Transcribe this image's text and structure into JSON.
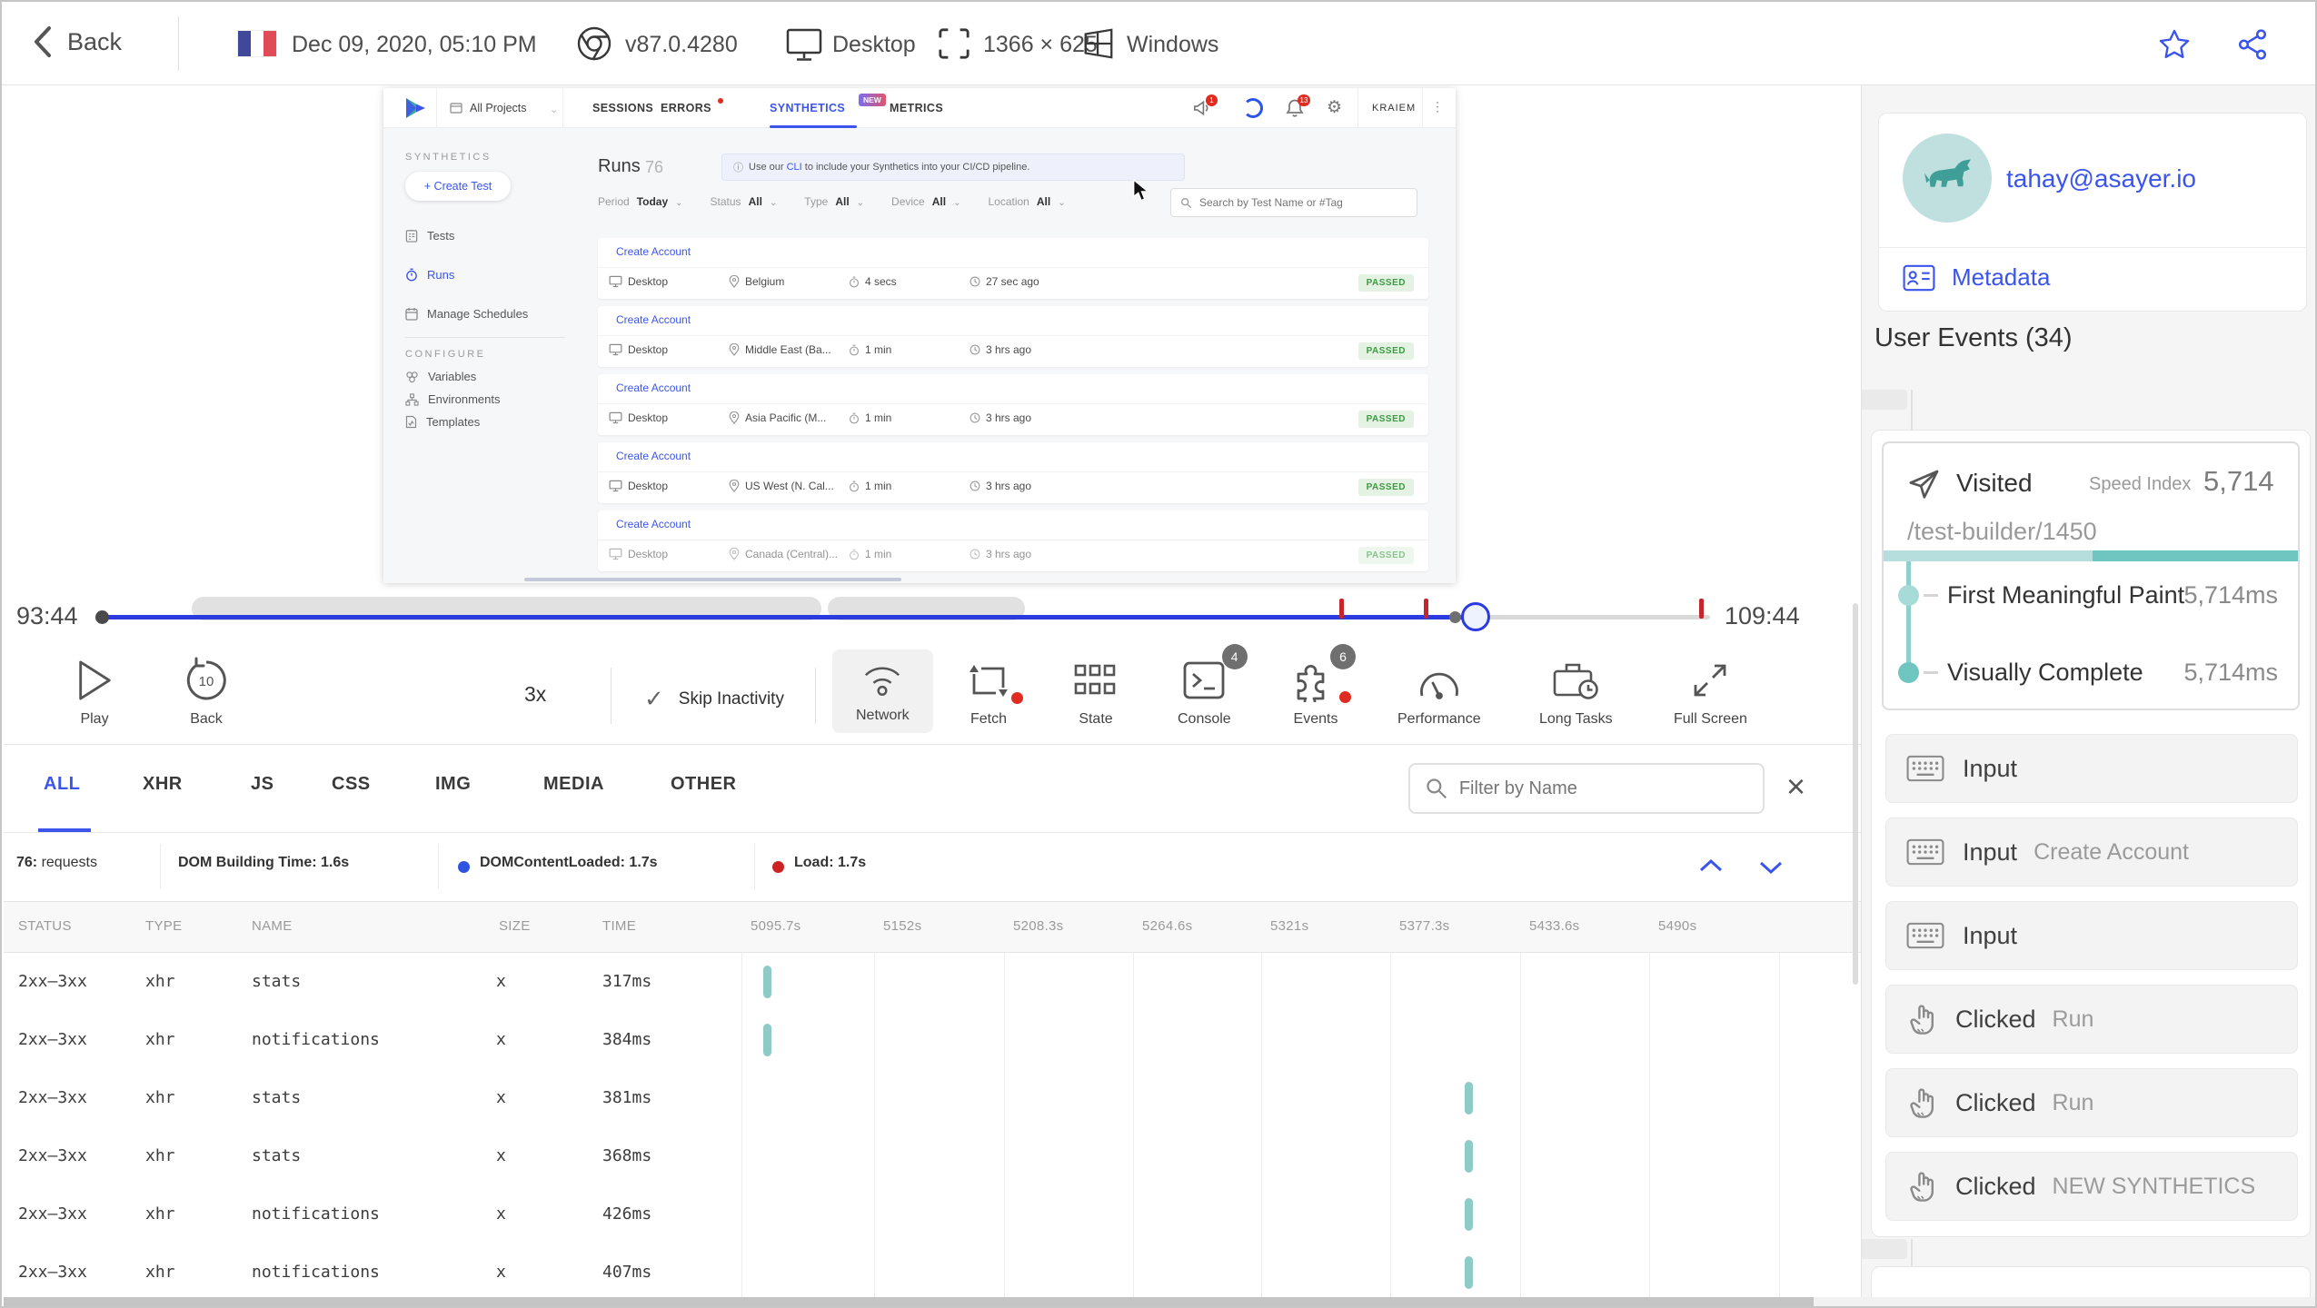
{
  "topbar": {
    "back_label": "Back",
    "session_date": "Dec 09, 2020, 05:10 PM",
    "browser_version": "v87.0.4280",
    "device": "Desktop",
    "resolution": "1366 × 625",
    "os": "Windows"
  },
  "app": {
    "project_selector": "All Projects",
    "tabs": [
      {
        "label": "SESSIONS"
      },
      {
        "label": "ERRORS"
      },
      {
        "label": "SYNTHETICS",
        "badge": "NEW"
      },
      {
        "label": "METRICS"
      }
    ],
    "notif_badge": "1",
    "bell_badge": "13",
    "user_menu": "KRAIEM",
    "sidebar": {
      "section_synthetics": "SYNTHETICS",
      "create_test": "+ Create Test",
      "tests": "Tests",
      "runs": "Runs",
      "manage_schedules": "Manage Schedules",
      "section_configure": "CONFIGURE",
      "variables": "Variables",
      "environments": "Environments",
      "templates": "Templates"
    },
    "runs_header": {
      "title": "Runs",
      "count": "76",
      "banner_pre": "Use our ",
      "banner_link": "CLI",
      "banner_post": " to include your Synthetics into your CI/CD pipeline.",
      "search_placeholder": "Search by Test Name or #Tag"
    },
    "filters": [
      {
        "label": "Period",
        "value": "Today"
      },
      {
        "label": "Status",
        "value": "All"
      },
      {
        "label": "Type",
        "value": "All"
      },
      {
        "label": "Device",
        "value": "All"
      },
      {
        "label": "Location",
        "value": "All"
      }
    ],
    "runs": [
      {
        "name": "Create Account",
        "device": "Desktop",
        "location": "Belgium",
        "duration": "4 secs",
        "ago": "27 sec ago",
        "status": "PASSED"
      },
      {
        "name": "Create Account",
        "device": "Desktop",
        "location": "Middle East (Ba...",
        "duration": "1 min",
        "ago": "3 hrs ago",
        "status": "PASSED"
      },
      {
        "name": "Create Account",
        "device": "Desktop",
        "location": "Asia Pacific (M...",
        "duration": "1 min",
        "ago": "3 hrs ago",
        "status": "PASSED"
      },
      {
        "name": "Create Account",
        "device": "Desktop",
        "location": "US West (N. Cal...",
        "duration": "1 min",
        "ago": "3 hrs ago",
        "status": "PASSED"
      },
      {
        "name": "Create Account",
        "device": "Desktop",
        "location": "Canada (Central)...",
        "duration": "1 min",
        "ago": "3 hrs ago",
        "status": "PASSED"
      }
    ]
  },
  "timeline": {
    "current": "93:44",
    "total": "109:44"
  },
  "controls": {
    "play": "Play",
    "back": "Back",
    "back_amount": "10",
    "speed": "3x",
    "skip_inactivity": "Skip Inactivity",
    "network": "Network",
    "fetch": "Fetch",
    "state": "State",
    "console": "Console",
    "console_badge": "4",
    "events": "Events",
    "events_badge": "6",
    "performance": "Performance",
    "long_tasks": "Long Tasks",
    "full_screen": "Full Screen"
  },
  "network_panel": {
    "tabs": [
      "ALL",
      "XHR",
      "JS",
      "CSS",
      "IMG",
      "MEDIA",
      "OTHER"
    ],
    "filter_placeholder": "Filter by Name",
    "summary": {
      "requests_count": "76:",
      "requests_label": "requests",
      "dom_building": "DOM Building Time: 1.6s",
      "dom_content_loaded": "DOMContentLoaded: 1.7s",
      "load": "Load: 1.7s"
    },
    "columns": [
      "STATUS",
      "TYPE",
      "NAME",
      "SIZE",
      "TIME"
    ],
    "time_columns": [
      "5095.7s",
      "5152s",
      "5208.3s",
      "5264.6s",
      "5321s",
      "5377.3s",
      "5433.6s",
      "5490s"
    ],
    "rows": [
      {
        "status": "2xx–3xx",
        "type": "xhr",
        "name": "stats",
        "size": "x",
        "time": "317ms"
      },
      {
        "status": "2xx–3xx",
        "type": "xhr",
        "name": "notifications",
        "size": "x",
        "time": "384ms"
      },
      {
        "status": "2xx–3xx",
        "type": "xhr",
        "name": "stats",
        "size": "x",
        "time": "381ms"
      },
      {
        "status": "2xx–3xx",
        "type": "xhr",
        "name": "stats",
        "size": "x",
        "time": "368ms"
      },
      {
        "status": "2xx–3xx",
        "type": "xhr",
        "name": "notifications",
        "size": "x",
        "time": "426ms"
      },
      {
        "status": "2xx–3xx",
        "type": "xhr",
        "name": "notifications",
        "size": "x",
        "time": "407ms"
      }
    ]
  },
  "sidebar": {
    "user_email": "tahay@asayer.io",
    "metadata_label": "Metadata",
    "user_events_title": "User Events (34)",
    "visited": {
      "label": "Visited",
      "speed_index_label": "Speed Index",
      "speed_index": "5,714",
      "url": "/test-builder/1450",
      "metrics": [
        {
          "name": "First Meaningful Paint",
          "value": "5,714ms"
        },
        {
          "name": "Visually Complete",
          "value": "5,714ms"
        }
      ]
    },
    "events": [
      {
        "label": "Input",
        "value": ""
      },
      {
        "label": "Input",
        "value": "Create Account"
      },
      {
        "label": "Input",
        "value": ""
      },
      {
        "label": "Clicked",
        "value": "Run"
      },
      {
        "label": "Clicked",
        "value": "Run"
      },
      {
        "label": "Clicked",
        "value": "NEW SYNTHETICS"
      }
    ]
  },
  "colors": {
    "accent_blue": "#3b55ec",
    "teal": "#76c7c2",
    "passed_green": "#3c9b40",
    "error_red": "#d32f2f",
    "timeline_blue": "#2b3be0"
  }
}
